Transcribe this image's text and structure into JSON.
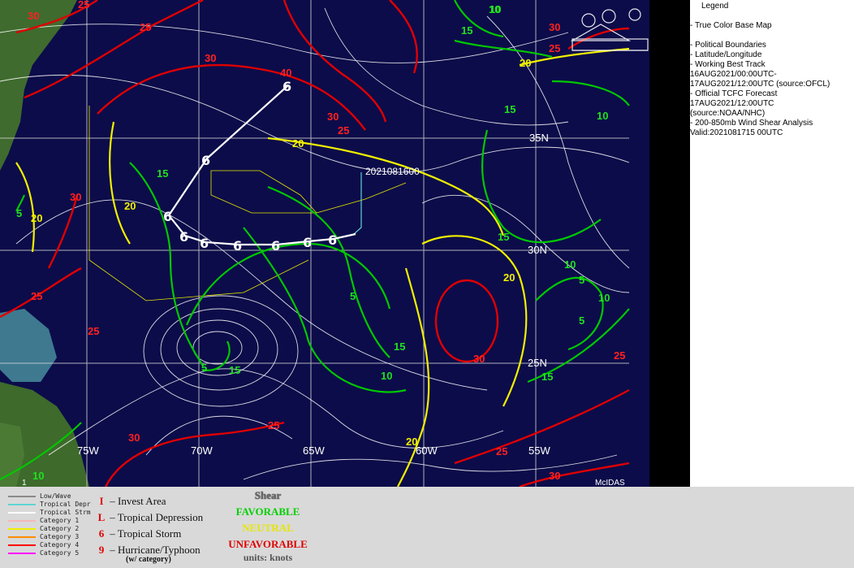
{
  "legend": {
    "title": "Legend",
    "items": [
      "True Color Base Map",
      "Political Boundaries",
      "Latitude/Longitude",
      "Working Best Track",
      "16AUG2021/00:00UTC-",
      "17AUG2021/12:00UTC   (source:OFCL)",
      "Official TCFC Forecast",
      "17AUG2021/12:00UTC",
      "(source:NOAA/NHC)",
      "200-850mb Wind Shear Analysis",
      "Valid:2021081715 00UTC"
    ]
  },
  "map": {
    "lat_labels": [
      "35N",
      "30N",
      "25N"
    ],
    "lon_labels": [
      "75W",
      "70W",
      "65W",
      "60W",
      "55W"
    ],
    "track_label": "2021081600",
    "brand": "McIDAS",
    "corner_marker": "1",
    "contour_labels": {
      "red": [
        "30",
        "25",
        "25",
        "30",
        "30",
        "25",
        "40",
        "30",
        "25",
        "25",
        "30",
        "25",
        "30",
        "25",
        "30",
        "25",
        "30",
        "25"
      ],
      "yellow": [
        "20",
        "20",
        "20",
        "20",
        "20",
        "20"
      ],
      "green": [
        "10",
        "15",
        "15",
        "10",
        "15",
        "5",
        "15",
        "10",
        "5",
        "15",
        "10",
        "5",
        "10",
        "5",
        "15",
        "15",
        "5",
        "10",
        "10"
      ]
    }
  },
  "key": {
    "lines": [
      {
        "label": "Low/Wave",
        "color": "#8a8a8a"
      },
      {
        "label": "Tropical Depr",
        "color": "#5fd3d3"
      },
      {
        "label": "Tropical Strm",
        "color": "#ffffff"
      },
      {
        "label": "Category 1",
        "color": "#f5b8b8"
      },
      {
        "label": "Category 2",
        "color": "#f0f000"
      },
      {
        "label": "Category 3",
        "color": "#ff8c00"
      },
      {
        "label": "Category 4",
        "color": "#ff0000"
      },
      {
        "label": "Category 5",
        "color": "#ff00ff"
      }
    ],
    "symbols": [
      {
        "glyph": "I",
        "label": "– Invest Area"
      },
      {
        "glyph": "L",
        "label": "– Tropical Depression"
      },
      {
        "glyph": "6",
        "label": "– Tropical Storm"
      },
      {
        "glyph": "9",
        "label": "– Hurricane/Typhoon"
      }
    ],
    "symbols_note": "(w/ category)",
    "shear": {
      "title": "Shear",
      "favorable": "FAVORABLE",
      "neutral": "NEUTRAL",
      "unfavorable": "UNFAVORABLE",
      "units": "units: knots"
    }
  }
}
